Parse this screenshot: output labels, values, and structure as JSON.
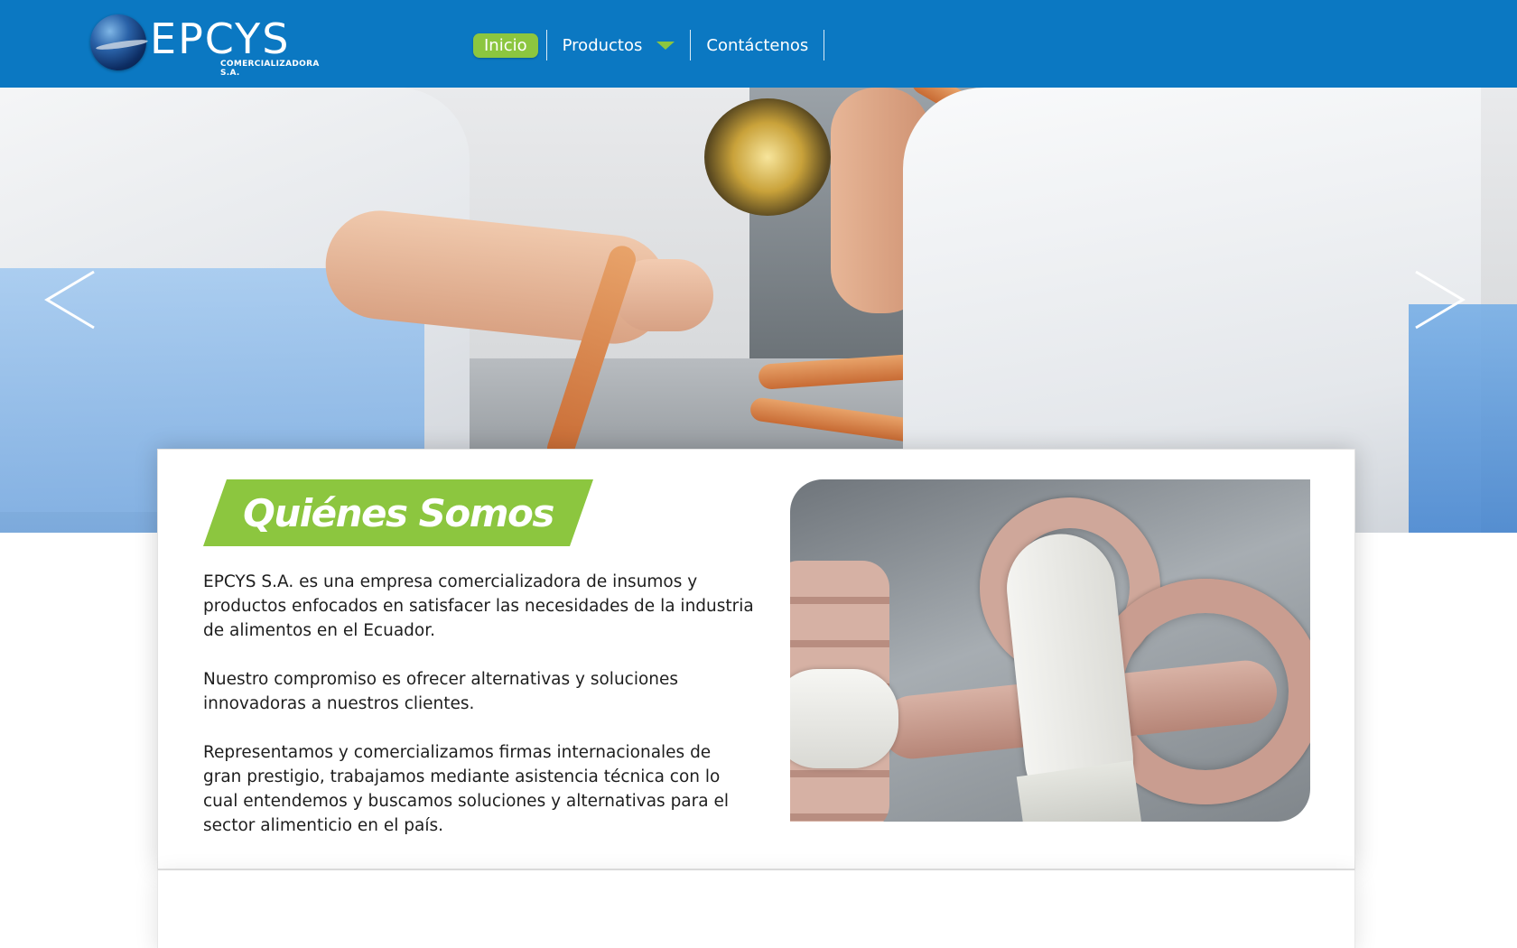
{
  "header": {
    "logo": {
      "wordmark": "EPCYS",
      "subtitle": "COMERCIALIZADORA S.A."
    },
    "nav": [
      {
        "label": "Inicio",
        "active": true
      },
      {
        "label": "Productos",
        "has_dropdown": true
      },
      {
        "label": "Contáctenos"
      }
    ],
    "colors": {
      "bar": "#0b78c2",
      "accent": "#8cc63f"
    }
  },
  "hero": {
    "image": "sausage-production-photo",
    "prev_icon": "chevron-left-icon",
    "next_icon": "chevron-right-icon"
  },
  "about": {
    "title": "Quiénes Somos",
    "paragraphs": [
      "EPCYS S.A. es una empresa comercializadora de insumos y productos enfocados en satisfacer las necesidades de la industria de alimentos en el Ecuador.",
      "Nuestro compromiso es ofrecer alternativas y soluciones innovadoras a nuestros clientes.",
      "Representamos y comercializamos firmas internacionales de gran prestigio, trabajamos mediante asistencia técnica con lo cual entendemos y buscamos soluciones y alternativas para el sector alimenticio en el país."
    ],
    "image": "gloved-hands-sausage-photo"
  }
}
